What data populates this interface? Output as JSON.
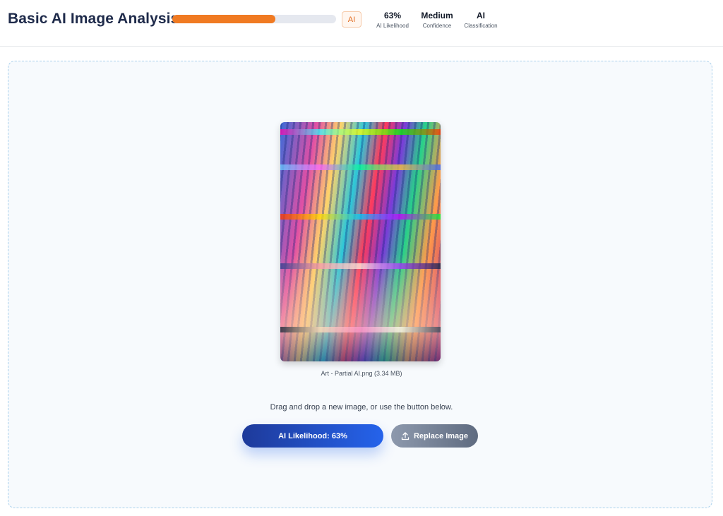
{
  "header": {
    "title": "Basic AI Image Analysis",
    "progress_value": 0.63,
    "verdict_badge": "AI",
    "stats": [
      {
        "value": "63%",
        "label": "AI Likelihood"
      },
      {
        "value": "Medium",
        "label": "Confidence"
      },
      {
        "value": "AI",
        "label": "Classification"
      }
    ],
    "accent_color": "#f07a22"
  },
  "preview": {
    "caption": "Art - Partial AI.png (3.34 MB)"
  },
  "dropzone": {
    "hint": "Drag and drop a new image, or use the button below."
  },
  "actions": {
    "likelihood_button": "AI Likelihood: 63%",
    "replace_button": "Replace Image",
    "replace_icon": "upload-icon"
  }
}
